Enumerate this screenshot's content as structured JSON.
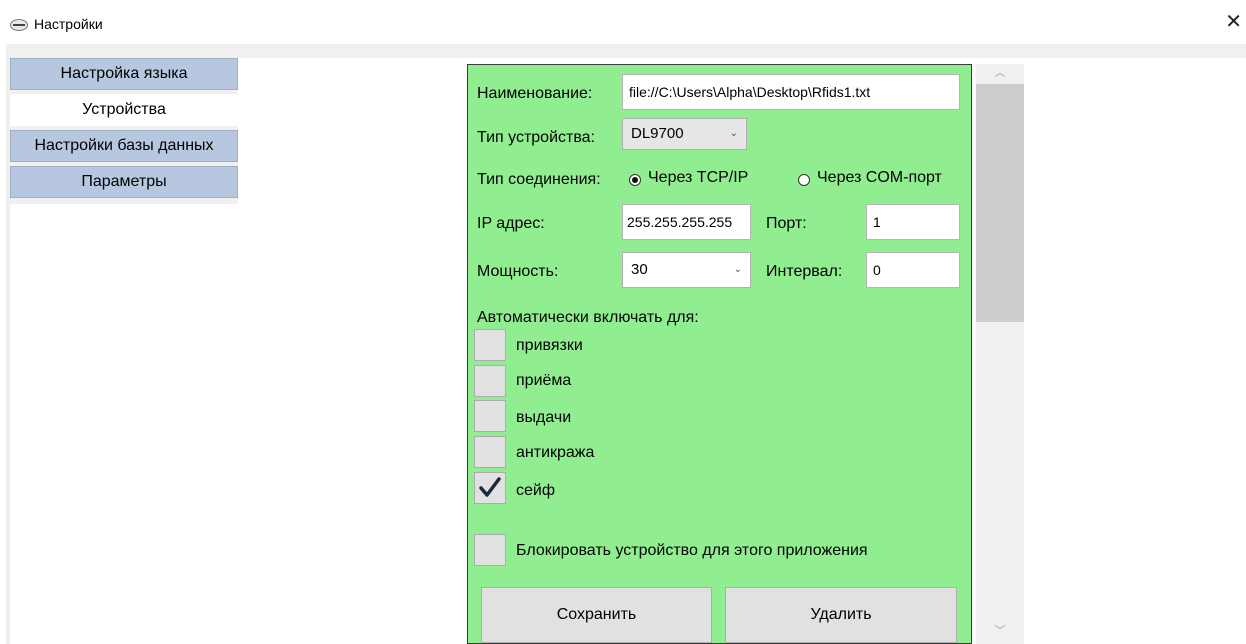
{
  "window": {
    "title": "Настройки",
    "close_glyph": "✕",
    "app_icon": "app-logo-icon"
  },
  "tabs": [
    {
      "label": "Настройка языка",
      "active": false
    },
    {
      "label": "Устройства",
      "active": true
    },
    {
      "label": "Настройки базы данных",
      "active": false
    },
    {
      "label": "Параметры",
      "active": false
    }
  ],
  "form": {
    "name_label": "Наименование:",
    "name_value": "file://C:\\Users\\Alpha\\Desktop\\Rfids1.txt",
    "device_type_label": "Тип устройства:",
    "device_type_value": "DL9700",
    "connection_label": "Тип соединения:",
    "radio_tcp": "Через TCP/IP",
    "radio_com": "Через COM-порт",
    "connection_selected": "tcp",
    "ip_label": "IP адрес:",
    "ip_value": "255.255.255.255",
    "port_label": "Порт:",
    "port_value": "1",
    "power_label": "Мощность:",
    "power_value": "30",
    "interval_label": "Интервал:",
    "interval_value": "0",
    "auto_label": "Автоматически включать для:",
    "auto_options": [
      {
        "label": "привязки",
        "checked": false
      },
      {
        "label": "приёма",
        "checked": false
      },
      {
        "label": "выдачи",
        "checked": false
      },
      {
        "label": "антикража",
        "checked": false
      },
      {
        "label": "сейф",
        "checked": true
      }
    ],
    "block_label": "Блокировать устройство для этого приложения",
    "block_checked": false,
    "save_label": "Сохранить",
    "delete_label": "Удалить"
  },
  "scrollbar": {
    "up_glyph": "︿",
    "down_glyph": "﹀"
  },
  "colors": {
    "form_bg": "#90ee90",
    "tab_bg": "#b7c7e0",
    "check_mark": "#1a2b3c"
  }
}
